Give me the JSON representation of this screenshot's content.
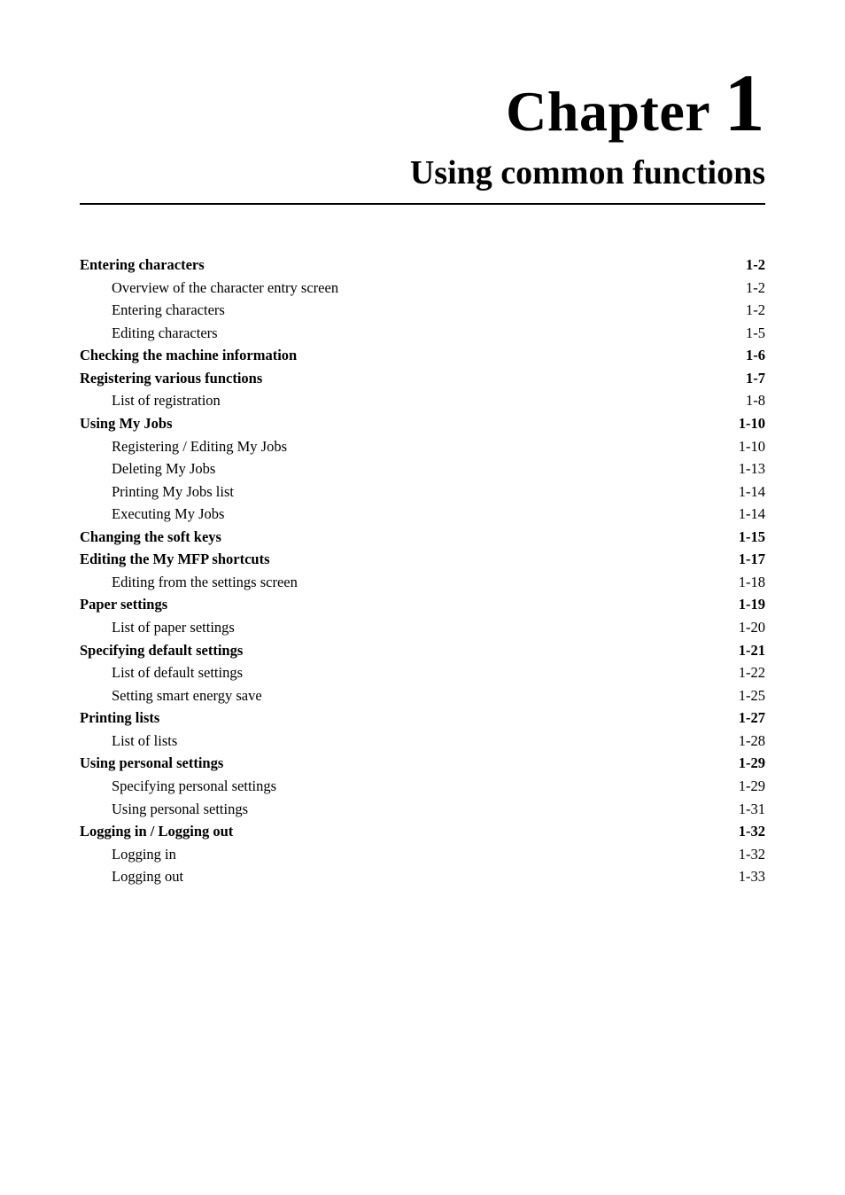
{
  "chapter": {
    "label": "Chapter",
    "number": "1",
    "subtitle": "Using common functions"
  },
  "toc": [
    {
      "level": 0,
      "title": "Entering characters",
      "page": "1-2"
    },
    {
      "level": 1,
      "title": "Overview of the character entry screen",
      "page": "1-2"
    },
    {
      "level": 1,
      "title": "Entering characters",
      "page": "1-2"
    },
    {
      "level": 1,
      "title": "Editing characters",
      "page": "1-5"
    },
    {
      "level": 0,
      "title": "Checking the machine information",
      "page": "1-6"
    },
    {
      "level": 0,
      "title": "Registering various functions",
      "page": "1-7"
    },
    {
      "level": 1,
      "title": "List of registration",
      "page": "1-8"
    },
    {
      "level": 0,
      "title": "Using My Jobs",
      "page": "1-10"
    },
    {
      "level": 1,
      "title": "Registering / Editing My Jobs",
      "page": "1-10"
    },
    {
      "level": 1,
      "title": "Deleting My Jobs",
      "page": "1-13"
    },
    {
      "level": 1,
      "title": "Printing My Jobs list",
      "page": "1-14"
    },
    {
      "level": 1,
      "title": "Executing My Jobs",
      "page": "1-14"
    },
    {
      "level": 0,
      "title": "Changing the soft keys",
      "page": "1-15"
    },
    {
      "level": 0,
      "title": "Editing the My MFP shortcuts",
      "page": "1-17"
    },
    {
      "level": 1,
      "title": "Editing from the settings screen",
      "page": "1-18"
    },
    {
      "level": 0,
      "title": "Paper settings",
      "page": "1-19"
    },
    {
      "level": 1,
      "title": "List of paper settings",
      "page": "1-20"
    },
    {
      "level": 0,
      "title": "Specifying default settings",
      "page": "1-21"
    },
    {
      "level": 1,
      "title": "List of default settings",
      "page": "1-22"
    },
    {
      "level": 1,
      "title": "Setting smart energy save",
      "page": "1-25"
    },
    {
      "level": 0,
      "title": "Printing lists",
      "page": "1-27"
    },
    {
      "level": 1,
      "title": "List of lists",
      "page": "1-28"
    },
    {
      "level": 0,
      "title": "Using personal settings",
      "page": "1-29"
    },
    {
      "level": 1,
      "title": "Specifying personal settings",
      "page": "1-29"
    },
    {
      "level": 1,
      "title": "Using personal settings",
      "page": "1-31"
    },
    {
      "level": 0,
      "title": "Logging in / Logging out",
      "page": "1-32"
    },
    {
      "level": 1,
      "title": "Logging in",
      "page": "1-32"
    },
    {
      "level": 1,
      "title": "Logging out",
      "page": "1-33"
    }
  ]
}
